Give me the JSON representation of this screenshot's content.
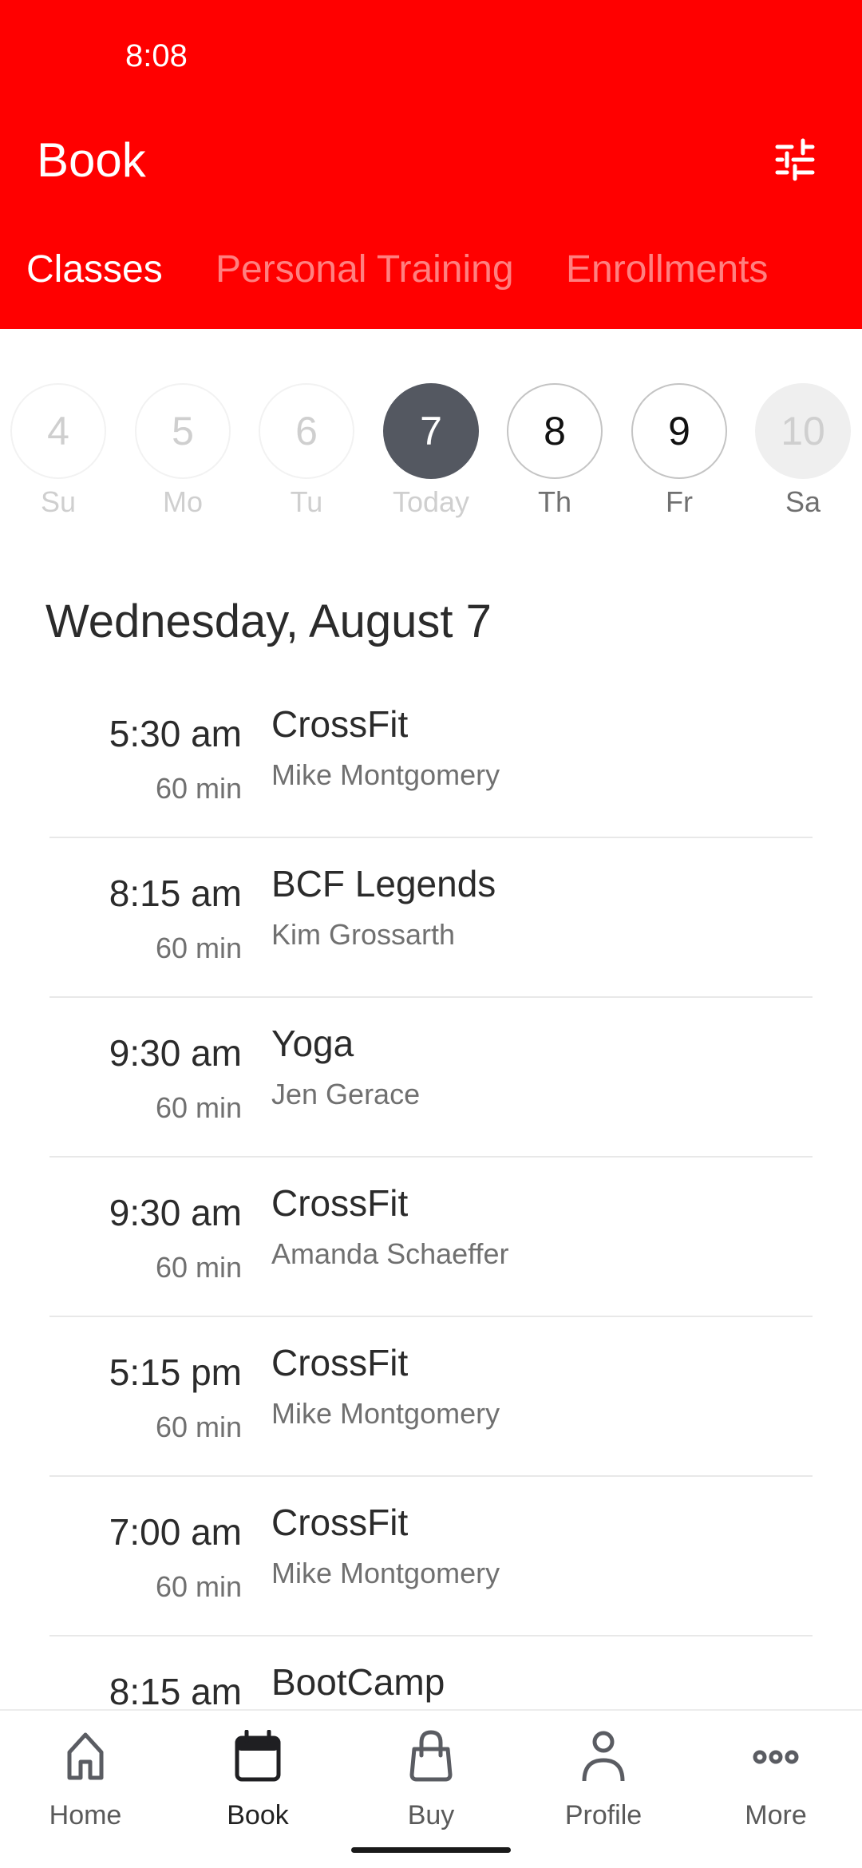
{
  "status_bar": {
    "time": "8:08"
  },
  "header": {
    "title": "Book",
    "filter_icon": "sliders-icon",
    "background_color": "#ff0000"
  },
  "tabs": [
    {
      "label": "Classes",
      "active": true
    },
    {
      "label": "Personal Training",
      "active": false
    },
    {
      "label": "Enrollments",
      "active": false
    }
  ],
  "days": [
    {
      "number": "4",
      "label": "Su",
      "state": "past"
    },
    {
      "number": "5",
      "label": "Mo",
      "state": "past"
    },
    {
      "number": "6",
      "label": "Tu",
      "state": "past"
    },
    {
      "number": "7",
      "label": "Today",
      "state": "selected"
    },
    {
      "number": "8",
      "label": "Th",
      "state": "future"
    },
    {
      "number": "9",
      "label": "Fr",
      "state": "future"
    },
    {
      "number": "10",
      "label": "Sa",
      "state": "disabled"
    }
  ],
  "date_heading": "Wednesday, August 7",
  "classes": [
    {
      "time": "5:30 am",
      "duration": "60 min",
      "name": "CrossFit",
      "coach": "Mike Montgomery"
    },
    {
      "time": "8:15 am",
      "duration": "60 min",
      "name": "BCF Legends",
      "coach": "Kim Grossarth"
    },
    {
      "time": "9:30 am",
      "duration": "60 min",
      "name": "Yoga",
      "coach": "Jen Gerace"
    },
    {
      "time": "9:30 am",
      "duration": "60 min",
      "name": "CrossFit",
      "coach": "Amanda Schaeffer"
    },
    {
      "time": "5:15 pm",
      "duration": "60 min",
      "name": "CrossFit",
      "coach": "Mike Montgomery"
    },
    {
      "time": "7:00 am",
      "duration": "60 min",
      "name": "CrossFit",
      "coach": "Mike Montgomery"
    },
    {
      "time": "8:15 am",
      "duration": "",
      "name": "BootCamp",
      "coach": ""
    }
  ],
  "bottom_nav": [
    {
      "label": "Home",
      "icon": "home-icon",
      "active": false
    },
    {
      "label": "Book",
      "icon": "calendar-icon",
      "active": true
    },
    {
      "label": "Buy",
      "icon": "shopping-bag-icon",
      "active": false
    },
    {
      "label": "Profile",
      "icon": "person-icon",
      "active": false
    },
    {
      "label": "More",
      "icon": "more-dots-icon",
      "active": false
    }
  ]
}
